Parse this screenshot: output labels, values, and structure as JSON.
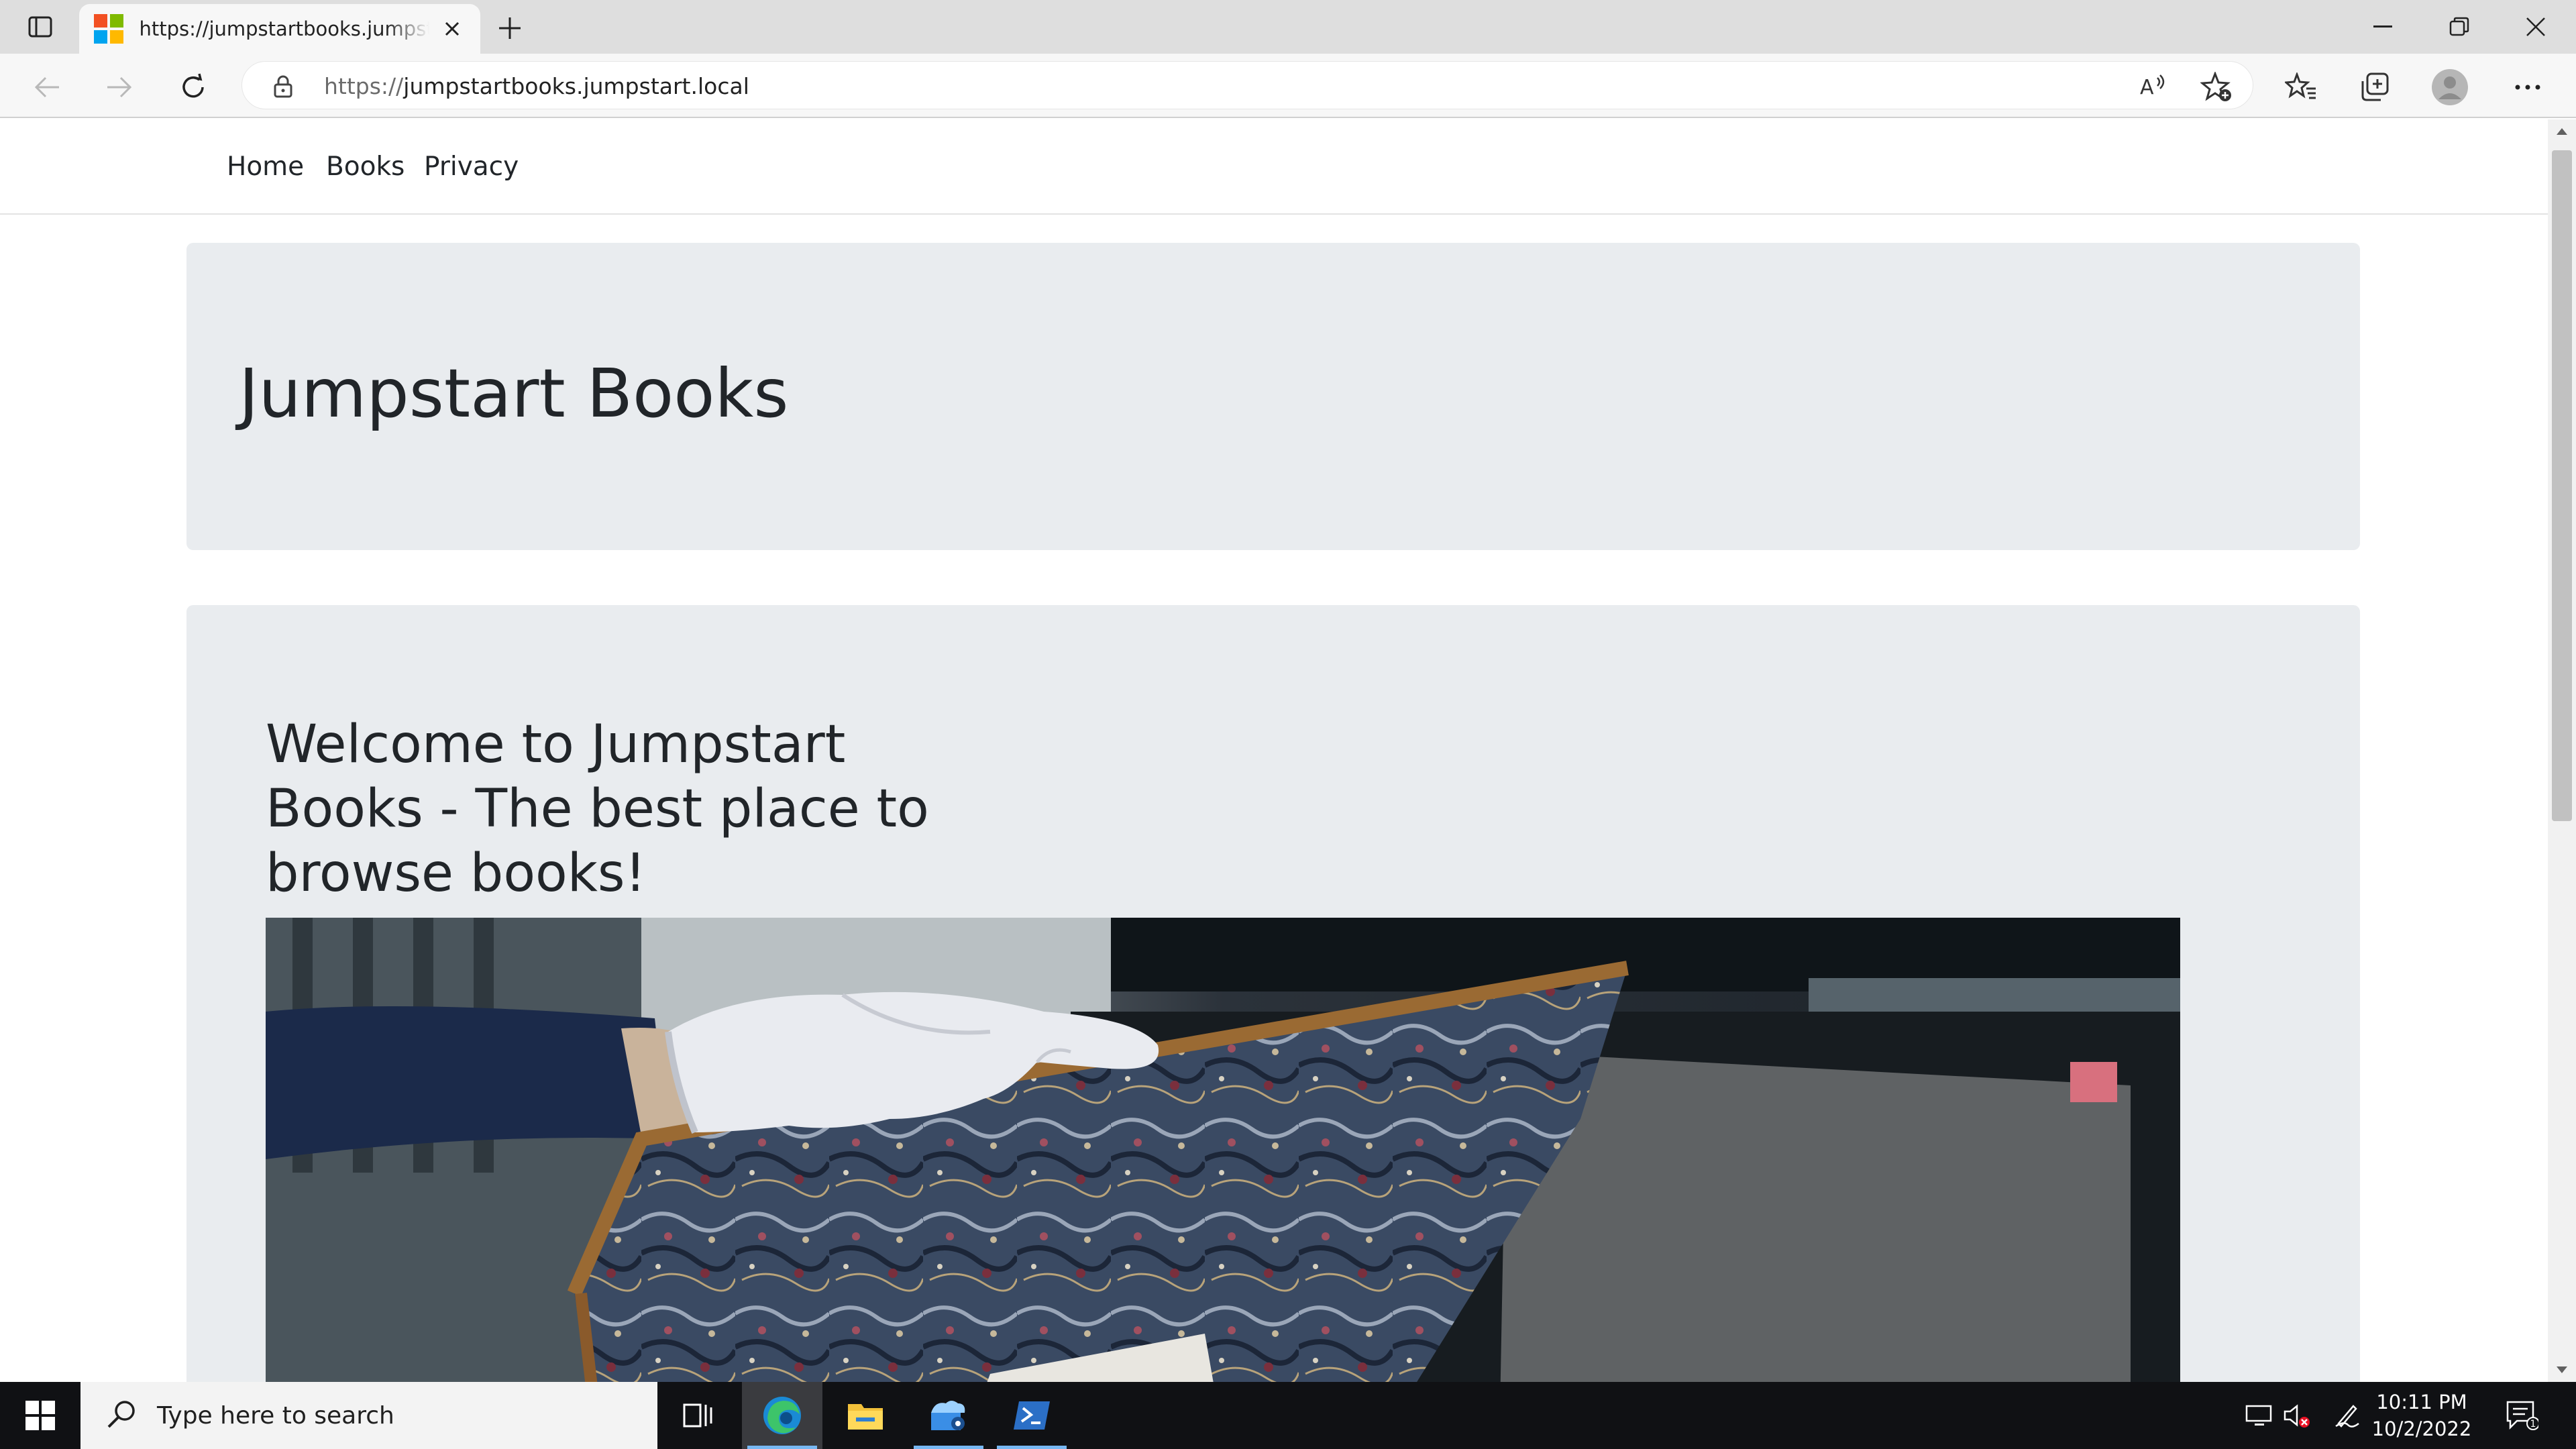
{
  "browser": {
    "tab_title": "https://jumpstartbooks.jumpstart.local",
    "address_prefix": "https://",
    "address_host": "jumpstartbooks.jumpstart.local",
    "icons": {
      "tab_actions": "tab-actions-icon",
      "favicon": "microsoft-logo-icon",
      "tab_close": "close-icon",
      "new_tab": "plus-icon",
      "minimize": "minimize-icon",
      "restore": "restore-icon",
      "close_window": "close-icon",
      "back": "back-arrow-icon",
      "forward": "forward-arrow-icon",
      "refresh": "refresh-icon",
      "lock": "lock-icon",
      "read_aloud": "read-aloud-icon",
      "add_favorite": "star-plus-icon",
      "favorites": "favorites-icon",
      "collections": "collections-icon",
      "profile": "profile-avatar-icon",
      "more": "ellipsis-icon"
    }
  },
  "nav": {
    "items": [
      {
        "label": "Home"
      },
      {
        "label": "Books"
      },
      {
        "label": "Privacy"
      }
    ]
  },
  "jumbotron": {
    "title": "Jumpstart Books"
  },
  "welcome": {
    "heading": "Welcome to Jumpstart Books - The best place to browse books!",
    "image": "gloved-hand-holding-marbled-book-cover"
  },
  "taskbar": {
    "search_placeholder": "Type here to search",
    "time": "10:11 PM",
    "date": "10/2/2022",
    "notification_count": "1",
    "apps": [
      "task-view-icon",
      "edge-icon",
      "file-explorer-icon",
      "server-manager-icon",
      "powershell-icon"
    ]
  },
  "colors": {
    "jumbotron_bg": "#e9ecef",
    "text": "#212529",
    "taskbar_bg": "#101114",
    "active_indicator": "#77b7f2"
  }
}
